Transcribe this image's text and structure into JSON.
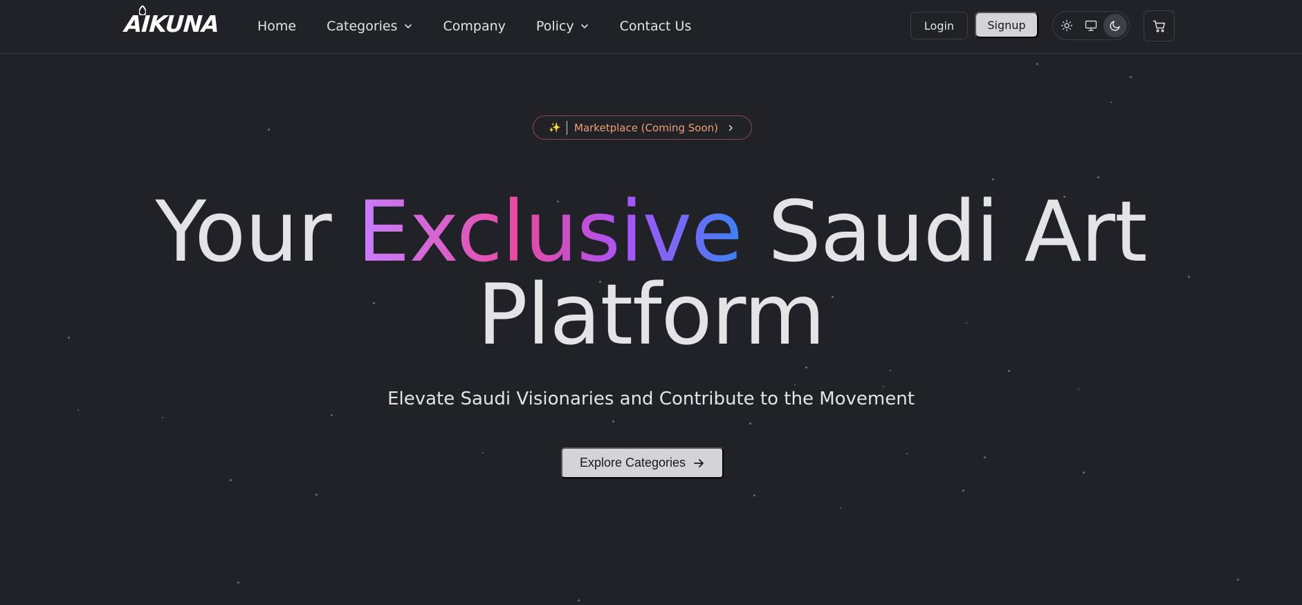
{
  "brand": {
    "logo_text": "AIKUNA"
  },
  "nav": {
    "items": [
      {
        "label": "Home",
        "dropdown": false
      },
      {
        "label": "Categories",
        "dropdown": true
      },
      {
        "label": "Company",
        "dropdown": false
      },
      {
        "label": "Policy",
        "dropdown": true
      },
      {
        "label": "Contact Us",
        "dropdown": false
      }
    ]
  },
  "auth": {
    "login_label": "Login",
    "signup_label": "Signup"
  },
  "theme": {
    "options": [
      "light-icon",
      "system-icon",
      "dark-icon"
    ],
    "selected": "dark"
  },
  "cart": {
    "icon": "cart-icon"
  },
  "hero": {
    "badge_icon": "sparkles-icon",
    "badge_text": "Marketplace (Coming Soon)",
    "headline_before": "Your",
    "headline_highlight": "Exclusive",
    "headline_after": "Saudi Art",
    "headline_line2": "Platform",
    "subtitle": "Elevate Saudi Visionaries and Contribute to the Movement",
    "cta_label": "Explore Categories"
  },
  "colors": {
    "background": "#212227",
    "text": "#e4e4e7",
    "button_light": "#d4d4d8",
    "badge_border": "#8a4a52",
    "badge_text": "#f0a070",
    "gradient": [
      "#c77dff",
      "#e84aa0",
      "#a855f7",
      "#3b82f6"
    ]
  }
}
